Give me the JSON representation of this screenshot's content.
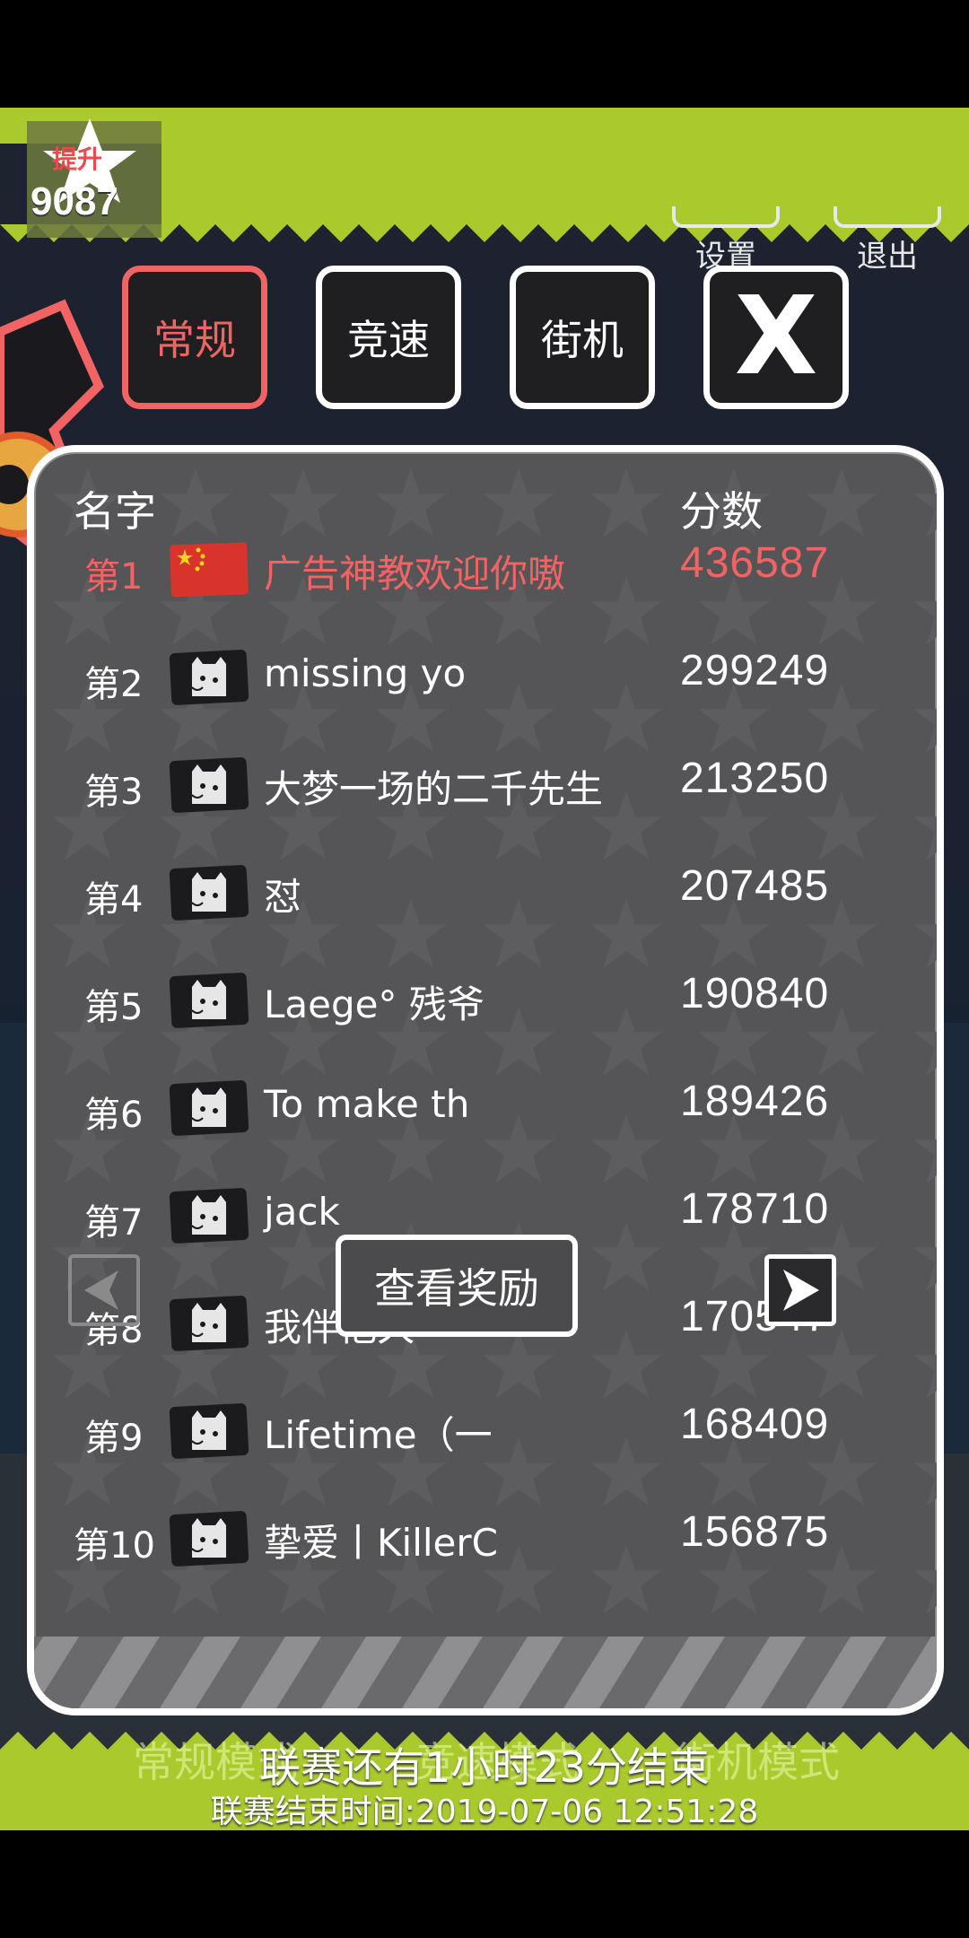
{
  "top_bar": {
    "promote_label": "提升",
    "coins": "9087",
    "settings_label": "设置",
    "exit_label": "退出"
  },
  "mode_tabs": [
    {
      "label": "常规",
      "active": true
    },
    {
      "label": "竞速",
      "active": false
    },
    {
      "label": "街机",
      "active": false
    }
  ],
  "close_label": "X",
  "leaderboard": {
    "header_name": "名字",
    "header_score": "分数",
    "rows": [
      {
        "rank": "第1",
        "name": "广告神教欢迎你嗷",
        "score": "436587",
        "avatar": "china-flag"
      },
      {
        "rank": "第2",
        "name": "missing yo",
        "score": "299249",
        "avatar": "cat-avatar"
      },
      {
        "rank": "第3",
        "name": "大梦一场的二千先生",
        "score": "213250",
        "avatar": "cat-avatar"
      },
      {
        "rank": "第4",
        "name": "怼",
        "score": "207485",
        "avatar": "cat-avatar"
      },
      {
        "rank": "第5",
        "name": "Laege°  残爷",
        "score": "190840",
        "avatar": "cat-avatar"
      },
      {
        "rank": "第6",
        "name": "To make th",
        "score": "189426",
        "avatar": "cat-avatar"
      },
      {
        "rank": "第7",
        "name": "jack",
        "score": "178710",
        "avatar": "cat-avatar"
      },
      {
        "rank": "第8",
        "name": "我伴他久",
        "score": "170547",
        "avatar": "cat-avatar"
      },
      {
        "rank": "第9",
        "name": "Lifetime（一",
        "score": "168409",
        "avatar": "cat-avatar"
      },
      {
        "rank": "第10",
        "name": "挚爱丨KillerC",
        "score": "156875",
        "avatar": "cat-avatar"
      }
    ],
    "reward_label": "查看奖励"
  },
  "bottom": {
    "ghost_modes": [
      "常规模式",
      "竞速模式",
      "街机模式"
    ],
    "league_remaining": "联赛还有1小时23分结束",
    "league_end_time": "联赛结束时间:2019-07-06 12:51:28"
  },
  "colors": {
    "lime": "#a9c92c",
    "highlight_red": "#f26464",
    "board_gray": "#555557"
  }
}
